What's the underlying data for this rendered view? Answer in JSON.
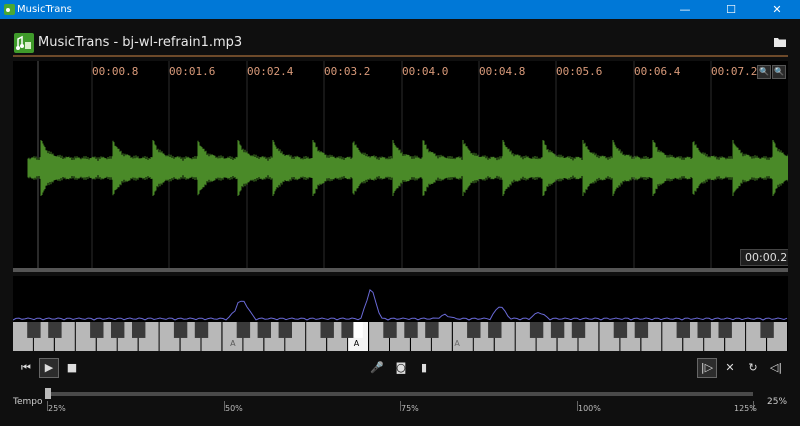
{
  "window": {
    "title": "MusicTrans",
    "minimize": "—",
    "maximize": "☐",
    "close": "✕"
  },
  "header": {
    "title": "MusicTrans - bj-wl-refrain1.mp3",
    "folder_icon": "folder-icon"
  },
  "waveform": {
    "ticks": [
      "00:00.8",
      "00:01.6",
      "00:02.4",
      "00:03.2",
      "00:04.0",
      "00:04.8",
      "00:05.6",
      "00:06.4",
      "00:07.2"
    ],
    "position": "00:00.2",
    "zoom_in": "🔍",
    "zoom_out": "🔍",
    "wave_color": "#4a8a28"
  },
  "spectrum": {
    "highlighted_note": "A",
    "key_labels": [
      "A",
      "A",
      "A"
    ],
    "line_color": "#6a6ad8"
  },
  "transport": {
    "skip_start": "⏮",
    "play": "▶",
    "stop": "■",
    "mic": "🎤",
    "loop_audio": "◙",
    "bars": "▮",
    "mark_in": "|▷",
    "clear": "✕",
    "repeat": "↻",
    "mark_out": "◁|"
  },
  "tempo": {
    "label": "Tempo",
    "value": "25%",
    "position": 0.0,
    "scale": [
      "25%",
      "50%",
      "75%",
      "100%",
      "125%"
    ]
  }
}
